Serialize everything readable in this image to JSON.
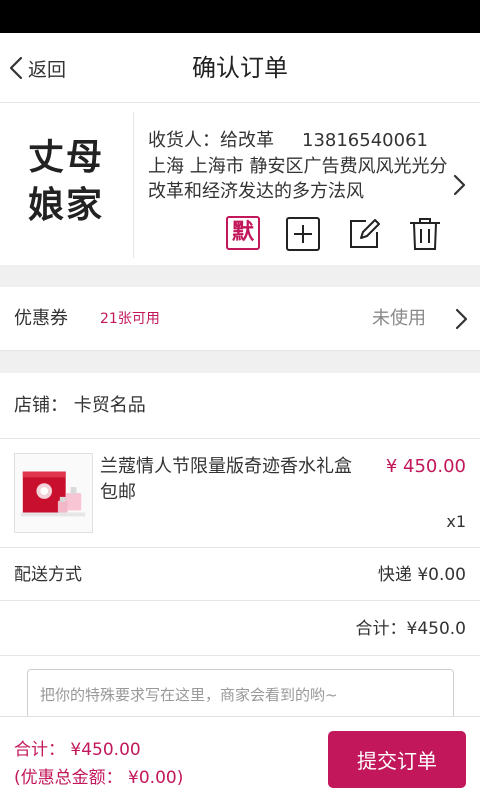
{
  "nav": {
    "back_label": "返回",
    "title": "确认订单"
  },
  "address": {
    "avatar_text": "丈母娘家",
    "consignee_label": "收货人：",
    "consignee_name": "给改革",
    "phone": "13816540061",
    "detail": "上海 上海市 静安区广告费风风光光分改革和经济发达的多方法风",
    "default_badge": "默",
    "icons": [
      "default-icon",
      "add-icon",
      "edit-icon",
      "delete-icon"
    ]
  },
  "coupon": {
    "label": "优惠券",
    "available": "21张可用",
    "status": "未使用"
  },
  "store": {
    "text": "店铺： 卡贸名品"
  },
  "product": {
    "name": "兰蔻情人节限量版奇迹香水礼盒 包邮",
    "price": "¥ 450.00",
    "quantity": "x1"
  },
  "shipping": {
    "label": "配送方式",
    "value": "快递 ¥0.00"
  },
  "subtotal": "合计：¥450.0",
  "remark": {
    "placeholder": "把你的特殊要求写在这里，商家会看到的哟~"
  },
  "footer": {
    "total": "合计： ¥450.00",
    "discount": "(优惠总金额： ¥0.00)",
    "submit_label": "提交订单"
  },
  "colors": {
    "accent": "#c2185b",
    "background": "#f0f0f0"
  }
}
